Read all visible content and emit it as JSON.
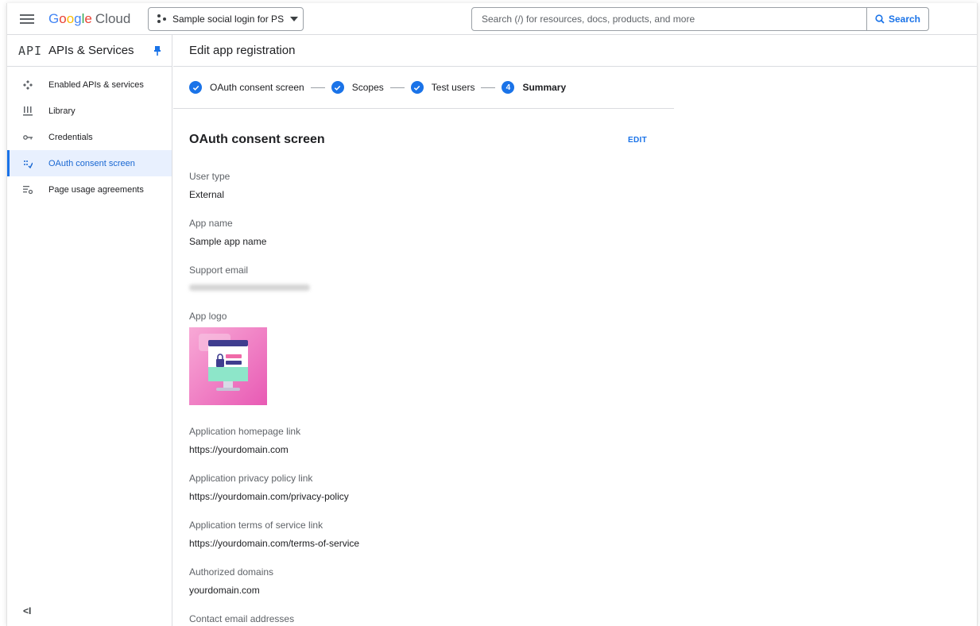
{
  "topbar": {
    "brand": "Google",
    "brand_suffix": "Cloud",
    "project_name": "Sample social login for PS",
    "search_placeholder": "Search (/) for resources, docs, products, and more",
    "search_button": "Search"
  },
  "sidebar": {
    "mark": "API",
    "title": "APIs & Services",
    "items": [
      {
        "label": "Enabled APIs & services",
        "icon": "enabled-apis-icon"
      },
      {
        "label": "Library",
        "icon": "library-icon"
      },
      {
        "label": "Credentials",
        "icon": "key-icon"
      },
      {
        "label": "OAuth consent screen",
        "icon": "consent-icon",
        "active": true
      },
      {
        "label": "Page usage agreements",
        "icon": "settings-list-icon"
      }
    ],
    "collapse_label": "<I"
  },
  "main": {
    "heading": "Edit app registration",
    "steps": [
      {
        "label": "OAuth consent screen",
        "state": "done"
      },
      {
        "label": "Scopes",
        "state": "done"
      },
      {
        "label": "Test users",
        "state": "done"
      },
      {
        "label": "Summary",
        "state": "current",
        "number": "4"
      }
    ],
    "section_title": "OAuth consent screen",
    "edit_label": "EDIT",
    "fields": {
      "user_type": {
        "label": "User type",
        "value": "External"
      },
      "app_name": {
        "label": "App name",
        "value": "Sample app name"
      },
      "support_email": {
        "label": "Support email"
      },
      "app_logo": {
        "label": "App logo"
      },
      "homepage": {
        "label": "Application homepage link",
        "value": "https://yourdomain.com"
      },
      "privacy": {
        "label": "Application privacy policy link",
        "value": "https://yourdomain.com/privacy-policy"
      },
      "terms": {
        "label": "Application terms of service link",
        "value": "https://yourdomain.com/terms-of-service"
      },
      "domains": {
        "label": "Authorized domains",
        "value": "yourdomain.com"
      },
      "contact": {
        "label": "Contact email addresses"
      }
    }
  },
  "colors": {
    "accent": "#1a73e8",
    "active_bg": "#e8f0fe",
    "logo_pink": "#e85ab4"
  }
}
